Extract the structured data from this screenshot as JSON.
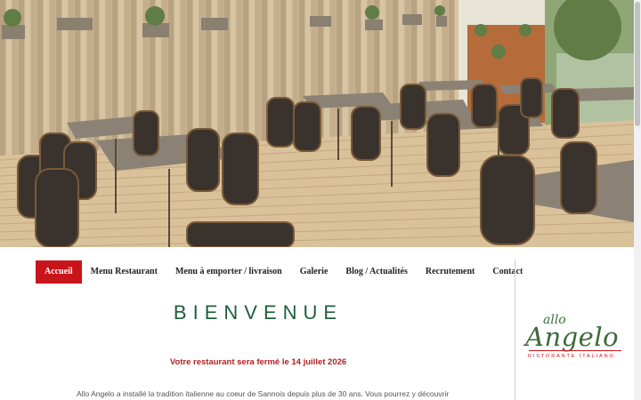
{
  "hero": {
    "image_description_icon": "restaurant-terrace-photo"
  },
  "nav": {
    "items": [
      {
        "label": "Accueil",
        "active": true
      },
      {
        "label": "Menu Restaurant",
        "active": false
      },
      {
        "label": "Menu à emporter / livraison",
        "active": false
      },
      {
        "label": "Galerie",
        "active": false
      },
      {
        "label": "Blog / Actualités",
        "active": false
      },
      {
        "label": "Recrutement",
        "active": false
      },
      {
        "label": "Contact",
        "active": false
      }
    ]
  },
  "main": {
    "title": "BIENVENUE",
    "notice": "Votre restaurant sera fermé le 14 juillet 2026",
    "intro": "Allo Angelo a installé la tradition italienne au coeur de Sannois depuis plus de 30 ans. Vous pourrez y découvrir"
  },
  "logo": {
    "allo": "allo",
    "angelo": "Angelo",
    "subtitle": "RISTORANTE ITALIANO"
  },
  "colors": {
    "accent": "#c8151b",
    "title_green": "#1f5f3b",
    "logo_green": "#3d6b3a"
  }
}
